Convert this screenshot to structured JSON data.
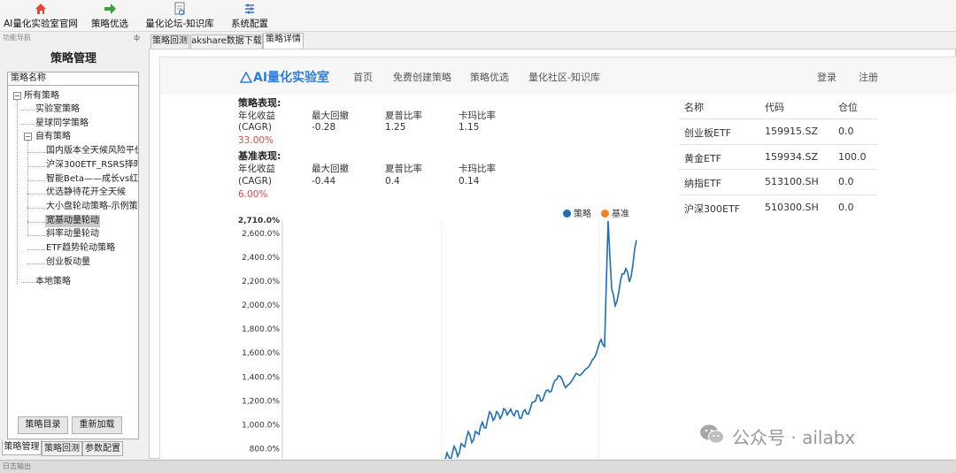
{
  "toolbar": {
    "items": [
      {
        "label": "AI量化实验室官网",
        "icon": "home-icon"
      },
      {
        "label": "策略优选",
        "icon": "arrow-icon"
      },
      {
        "label": "量化论坛-知识库",
        "icon": "document-icon"
      },
      {
        "label": "系统配置",
        "icon": "settings-icon"
      }
    ]
  },
  "dock": {
    "title": "功能导航",
    "pin": "ф",
    "panel_title": "策略管理",
    "tree_header": "策略名称",
    "tree": {
      "root": "所有策略",
      "lab": "实验室策略",
      "planet": "星球同学策略",
      "own": "自有策略",
      "own_items": [
        "国内版本全天候风险平价",
        "沪深300ETF_RSRS择时策",
        "智能Beta——成长vs红利",
        "优选静待花开全天候",
        "大小盘轮动策略-示例策略",
        "宽基动量轮动",
        "斜率动量轮动",
        "ETF趋势轮动策略",
        "创业板动量"
      ],
      "local": "本地策略"
    },
    "buttons": {
      "catalog": "策略目录",
      "reload": "重新加载"
    },
    "tabs": [
      "策略管理",
      "策略回测",
      "参数配置"
    ]
  },
  "tabs": [
    "策略回测",
    "akshare数据下载",
    "策略详情"
  ],
  "site": {
    "logo": "AI量化实验室",
    "nav": [
      "首页",
      "免费创建策略",
      "策略优选",
      "量化社区-知识库"
    ],
    "login": "登录",
    "register": "注册"
  },
  "strategy_perf": {
    "title": "策略表现:",
    "headers": [
      "年化收益",
      "最大回撤",
      "夏普比率",
      "卡玛比率"
    ],
    "cagr_label": "(CAGR)",
    "values": [
      "-0.28",
      "1.25",
      "1.15"
    ],
    "annual": "33.00%"
  },
  "benchmark_perf": {
    "title": "基准表现:",
    "headers": [
      "年化收益",
      "最大回撤",
      "夏普比率",
      "卡玛比率"
    ],
    "cagr_label": "(CAGR)",
    "values": [
      "-0.44",
      "0.4",
      "0.14"
    ],
    "annual": "6.00%"
  },
  "holdings": {
    "headers": [
      "名称",
      "代码",
      "仓位"
    ],
    "rows": [
      [
        "创业板ETF",
        "159915.SZ",
        "0.0"
      ],
      [
        "黄金ETF",
        "159934.SZ",
        "100.0"
      ],
      [
        "纳指ETF",
        "513100.SH",
        "0.0"
      ],
      [
        "沪深300ETF",
        "510300.SH",
        "0.0"
      ]
    ]
  },
  "watermark": {
    "text": "公众号 · ailabx",
    "icon": "wechat-icon"
  },
  "statusbar": "日志输出",
  "colors": {
    "strategy": "#1f6db3",
    "benchmark": "#f58220",
    "accent_red": "#e24646"
  },
  "chart_data": {
    "type": "line",
    "y_ticks": [
      "2,710.0%",
      "2,600.0%",
      "2,400.0%",
      "2,200.0%",
      "2,000.0%",
      "1,800.0%",
      "1,600.0%",
      "1,400.0%",
      "1,200.0%",
      "1,000.0%",
      "800.0%"
    ],
    "ylim": [
      700,
      2710
    ],
    "series": [
      {
        "name": "策略",
        "color": "#1f6db3",
        "values": [
          650,
          700,
          720,
          760,
          800,
          780,
          830,
          880,
          900,
          870,
          940,
          1000,
          980,
          1040,
          1080,
          1050,
          1100,
          1090,
          1130,
          1100,
          1080,
          1110,
          1060,
          1120,
          1100,
          1130,
          1180,
          1240,
          1200,
          1260,
          1300,
          1280,
          1360,
          1400,
          1380,
          1320,
          1350,
          1380,
          1420,
          1400,
          1440,
          1480,
          1520,
          1560,
          1620,
          1700,
          1650,
          2710,
          2150,
          2000,
          2100,
          2250,
          2300,
          2200,
          2350,
          2550
        ]
      },
      {
        "name": "基准",
        "color": "#f58220",
        "values": []
      }
    ]
  }
}
